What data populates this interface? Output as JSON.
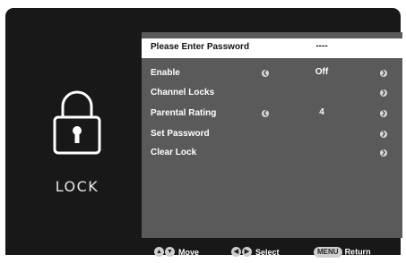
{
  "sidebar": {
    "title": "LOCK",
    "icon": "padlock-icon"
  },
  "menu": {
    "rows": [
      {
        "label": "Please Enter Password",
        "value": "----",
        "left_arrow": false,
        "right_arrow": false
      },
      {
        "label": "Enable",
        "value": "Off",
        "left_arrow": true,
        "right_arrow": true
      },
      {
        "label": "Channel Locks",
        "value": "",
        "left_arrow": false,
        "right_arrow": true
      },
      {
        "label": "Parental Rating",
        "value": "4",
        "left_arrow": true,
        "right_arrow": true
      },
      {
        "label": "Set Password",
        "value": "",
        "left_arrow": false,
        "right_arrow": true
      },
      {
        "label": "Clear Lock",
        "value": "",
        "left_arrow": false,
        "right_arrow": true
      }
    ]
  },
  "footer": {
    "move_label": "Move",
    "select_label": "Select",
    "menu_key": "MENU",
    "return_label": "Return"
  },
  "colors": {
    "background": "#181818",
    "panel": "#5a5a5a",
    "highlight": "#ffffff"
  }
}
